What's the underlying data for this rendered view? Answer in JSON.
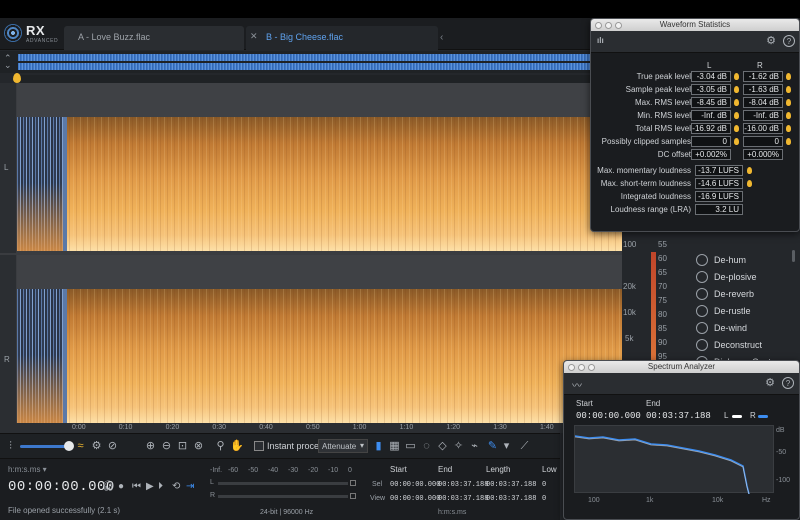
{
  "app": {
    "logo_text": "RX",
    "logo_sub": "ADVANCED"
  },
  "tabs": [
    {
      "label": "A - Love Buzz.flac",
      "active": false
    },
    {
      "label": "B - Big Cheese.flac",
      "active": true
    }
  ],
  "channels": {
    "left": "L",
    "right": "R"
  },
  "time_axis": {
    "ticks": [
      {
        "label": "0:00",
        "pos": 0.0
      },
      {
        "label": "0:10",
        "pos": 0.1
      },
      {
        "label": "0:20",
        "pos": 0.2
      },
      {
        "label": "0:30",
        "pos": 0.3
      },
      {
        "label": "0:40",
        "pos": 0.4
      },
      {
        "label": "0:50",
        "pos": 0.5
      },
      {
        "label": "1:00",
        "pos": 0.6
      },
      {
        "label": "1:10",
        "pos": 0.7
      },
      {
        "label": "1:20",
        "pos": 0.8
      },
      {
        "label": "1:30",
        "pos": 0.9
      },
      {
        "label": "1:40",
        "pos": 1.0
      }
    ]
  },
  "scale_strip": {
    "freq_labels": [
      "100",
      "20k",
      "10k",
      "5k"
    ],
    "db_labels": [
      "55",
      "60",
      "65",
      "70",
      "75",
      "80",
      "85",
      "90",
      "95"
    ]
  },
  "modules": [
    {
      "label": "De-hum",
      "icon": "de-hum-icon"
    },
    {
      "label": "De-plosive",
      "icon": "de-plosive-icon"
    },
    {
      "label": "De-reverb",
      "icon": "de-reverb-icon"
    },
    {
      "label": "De-rustle",
      "icon": "de-rustle-icon"
    },
    {
      "label": "De-wind",
      "icon": "de-wind-icon"
    },
    {
      "label": "Deconstruct",
      "icon": "deconstruct-icon"
    },
    {
      "label": "Dialogue Contour",
      "icon": "dialogue-contour-icon"
    }
  ],
  "toolbar": {
    "instant_process_label": "Instant process",
    "attenuate_value": "Attenuate"
  },
  "transport": {
    "time_format": "h:m:s.ms",
    "timecode": "00:00:00.000",
    "status": "File opened successfully (2.1 s)",
    "meter_ticks": [
      "-Inf.",
      "-60",
      "-50",
      "-40",
      "-30",
      "-20",
      "-10",
      "0"
    ],
    "meter_channels": [
      "L",
      "R"
    ],
    "bit_info": "24-bit | 96000 Hz",
    "hms_label": "h:m:s.ms",
    "sel_view": {
      "headers": [
        "Start",
        "End",
        "Length",
        "Low"
      ],
      "rows": [
        {
          "label": "Sel",
          "start": "00:00:00.000",
          "end": "00:03:37.188",
          "length": "00:03:37.188",
          "low": "0"
        },
        {
          "label": "View",
          "start": "00:00:00.000",
          "end": "00:03:37.188",
          "length": "00:03:37.188",
          "low": "0"
        }
      ]
    }
  },
  "waveform_stats": {
    "title": "Waveform Statistics",
    "col_left": "L",
    "col_right": "R",
    "rows": [
      {
        "label": "True peak level",
        "l": "-3.04 dB",
        "r": "-1.62 dB"
      },
      {
        "label": "Sample peak level",
        "l": "-3.05 dB",
        "r": "-1.63 dB"
      },
      {
        "label": "Max. RMS level",
        "l": "-8.45 dB",
        "r": "-8.04 dB"
      },
      {
        "label": "Min. RMS level",
        "l": "-Inf. dB",
        "r": "-Inf. dB"
      },
      {
        "label": "Total RMS level",
        "l": "-16.92 dB",
        "r": "-16.00 dB"
      },
      {
        "label": "Possibly clipped samples",
        "l": "0",
        "r": "0"
      },
      {
        "label": "DC offset",
        "l": "+0.002%",
        "r": "+0.000%"
      }
    ],
    "loudness": [
      {
        "label": "Max. momentary loudness",
        "value": "-13.7 LUFS"
      },
      {
        "label": "Max. short-term loudness",
        "value": "-14.6 LUFS"
      },
      {
        "label": "Integrated loudness",
        "value": "-16.9 LUFS"
      },
      {
        "label": "Loudness range (LRA)",
        "value": "3.2 LU"
      }
    ]
  },
  "spectrum_analyzer": {
    "title": "Spectrum Analyzer",
    "start_label": "Start",
    "end_label": "End",
    "start_value": "00:00:00.000",
    "end_value": "00:03:37.188",
    "legend_left": "L",
    "legend_right": "R",
    "left_color": "#ffffff",
    "right_color": "#3d8df0",
    "y_labels": [
      "dB",
      "-50",
      "-100"
    ],
    "x_labels": [
      "100",
      "1k",
      "10k",
      "Hz"
    ]
  }
}
